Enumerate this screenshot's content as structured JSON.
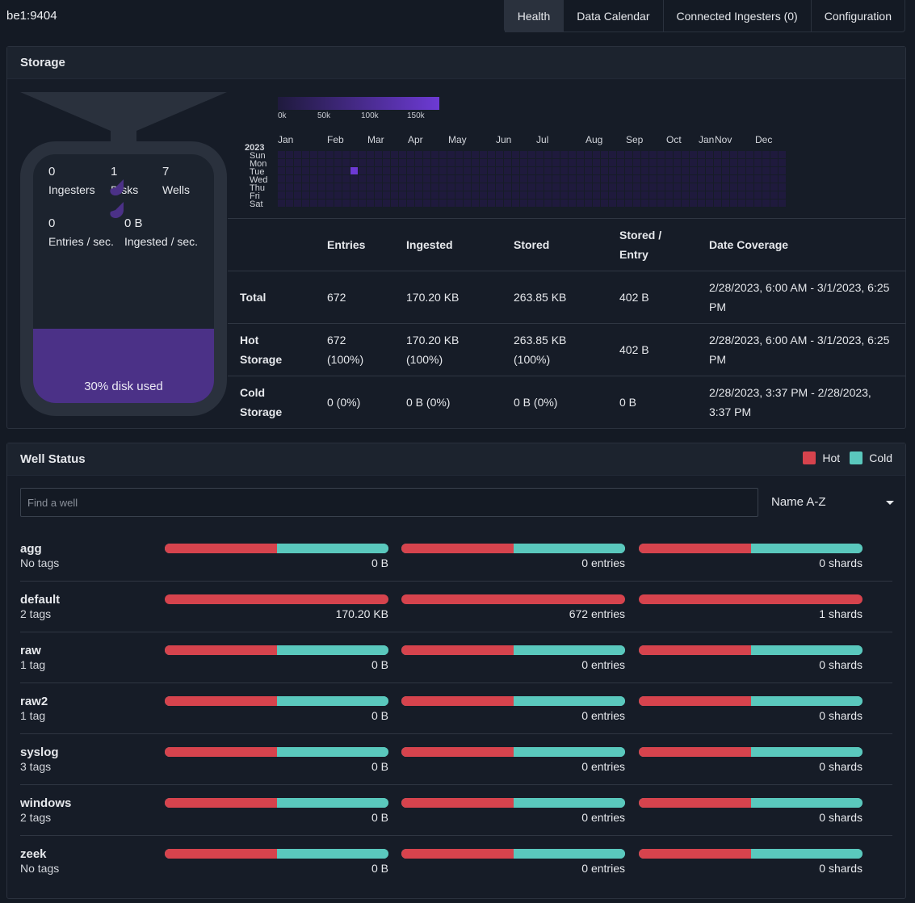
{
  "header": {
    "host": "be1:9404",
    "tabs": [
      "Health",
      "Data Calendar",
      "Connected Ingesters (0)",
      "Configuration"
    ],
    "active_tab": "Health"
  },
  "storage": {
    "title": "Storage",
    "stats": {
      "ingesters": "0",
      "ingesters_label": "Ingesters",
      "disks": "1",
      "disks_label": "Disks",
      "wells": "7",
      "wells_label": "Wells",
      "eps": "0",
      "eps_label": "Entries / sec.",
      "ingested": "0 B",
      "ingested_label": "Ingested / sec."
    },
    "disk_used_fraction": 0.3,
    "disk_used_label": "30% disk used",
    "heatmap": {
      "legend_ticks": [
        "0k",
        "50k",
        "100k",
        "150k"
      ],
      "year": "2023",
      "months": [
        "Jan",
        "Feb",
        "Mar",
        "Apr",
        "May",
        "Jun",
        "Jul",
        "Aug",
        "Sep",
        "Oct",
        "Jan",
        "Nov",
        "Dec"
      ],
      "days": [
        "Sun",
        "Mon",
        "Tue",
        "Wed",
        "Thu",
        "Fri",
        "Sat"
      ],
      "active_week": 9,
      "active_day": 2,
      "active_color": "#6d3ad4",
      "empty_color": "#1f1a3d"
    },
    "table": {
      "headers": [
        "",
        "Entries",
        "Ingested",
        "Stored",
        "Stored / Entry",
        "Date Coverage"
      ],
      "rows": [
        [
          "Total",
          "672",
          "170.20 KB",
          "263.85 KB",
          "402 B",
          "2/28/2023, 6:00 AM - 3/1/2023, 6:25 PM"
        ],
        [
          "Hot Storage",
          "672 (100%)",
          "170.20 KB (100%)",
          "263.85 KB (100%)",
          "402 B",
          "2/28/2023, 6:00 AM - 3/1/2023, 6:25 PM"
        ],
        [
          "Cold Storage",
          "0 (0%)",
          "0 B (0%)",
          "0 B (0%)",
          "0 B",
          "2/28/2023, 3:37 PM - 2/28/2023, 3:37 PM"
        ]
      ]
    }
  },
  "well_status": {
    "title": "Well Status",
    "legend": [
      {
        "label": "Hot",
        "color": "#d6434d"
      },
      {
        "label": "Cold",
        "color": "#5ac8bd"
      }
    ],
    "search_placeholder": "Find a well",
    "sort": "Name A-Z",
    "wells": [
      {
        "name": "agg",
        "tags": "No tags",
        "hot_fraction": 0.5,
        "size": "0 B",
        "entries": "0 entries",
        "shards": "0 shards"
      },
      {
        "name": "default",
        "tags": "2 tags",
        "hot_fraction": 1.0,
        "size": "170.20 KB",
        "entries": "672 entries",
        "shards": "1 shards"
      },
      {
        "name": "raw",
        "tags": "1 tag",
        "hot_fraction": 0.5,
        "size": "0 B",
        "entries": "0 entries",
        "shards": "0 shards"
      },
      {
        "name": "raw2",
        "tags": "1 tag",
        "hot_fraction": 0.5,
        "size": "0 B",
        "entries": "0 entries",
        "shards": "0 shards"
      },
      {
        "name": "syslog",
        "tags": "3 tags",
        "hot_fraction": 0.5,
        "size": "0 B",
        "entries": "0 entries",
        "shards": "0 shards"
      },
      {
        "name": "windows",
        "tags": "2 tags",
        "hot_fraction": 0.5,
        "size": "0 B",
        "entries": "0 entries",
        "shards": "0 shards"
      },
      {
        "name": "zeek",
        "tags": "No tags",
        "hot_fraction": 0.5,
        "size": "0 B",
        "entries": "0 entries",
        "shards": "0 shards"
      }
    ]
  }
}
